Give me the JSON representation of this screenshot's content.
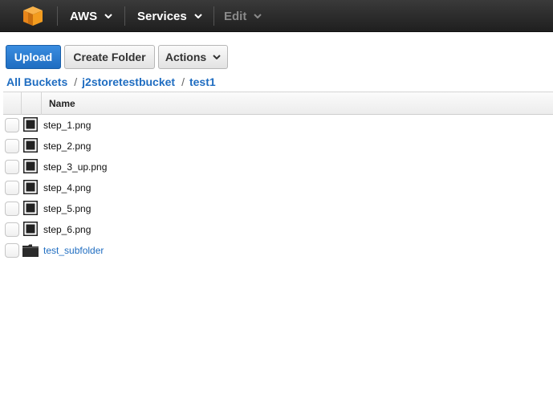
{
  "nav": {
    "logo_icon": "aws-cube-icon",
    "aws_label": "AWS",
    "services_label": "Services",
    "edit_label": "Edit"
  },
  "toolbar": {
    "upload_label": "Upload",
    "create_folder_label": "Create Folder",
    "actions_label": "Actions"
  },
  "breadcrumb": {
    "all_buckets": "All Buckets",
    "bucket": "j2storetestbucket",
    "folder": "test1",
    "separator": "/"
  },
  "table": {
    "name_header": "Name",
    "rows": [
      {
        "name": "step_1.png",
        "type": "file"
      },
      {
        "name": "step_2.png",
        "type": "file"
      },
      {
        "name": "step_3_up.png",
        "type": "file"
      },
      {
        "name": "step_4.png",
        "type": "file"
      },
      {
        "name": "step_5.png",
        "type": "file"
      },
      {
        "name": "step_6.png",
        "type": "file"
      },
      {
        "name": "test_subfolder",
        "type": "folder"
      }
    ]
  },
  "colors": {
    "accent": "#1f6dc1",
    "topbar": "#2b2b2b",
    "logo": "#f7981d"
  }
}
